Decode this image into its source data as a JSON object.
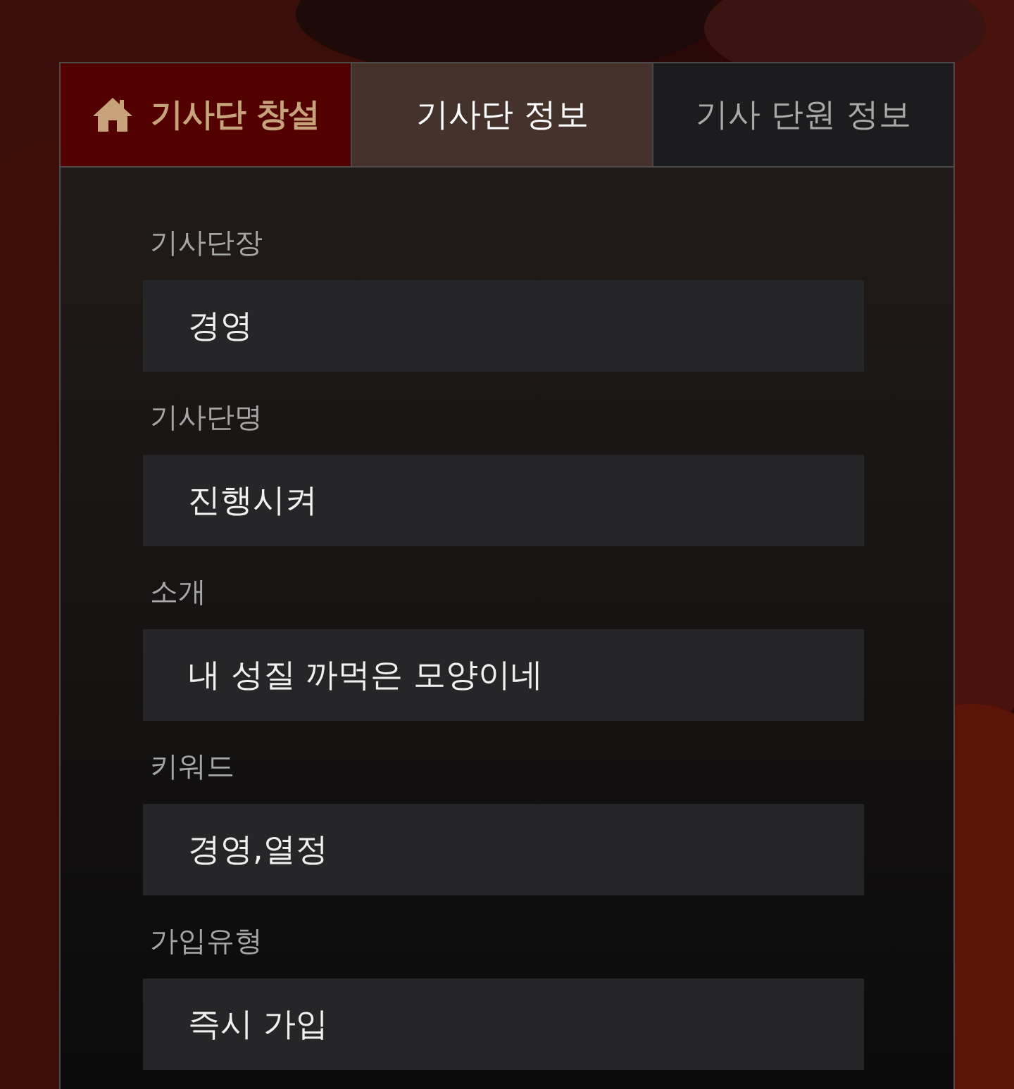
{
  "tabs": [
    {
      "label": "기사단 창설",
      "kind": "action",
      "selected": false
    },
    {
      "label": "기사단 정보",
      "kind": "tab",
      "selected": true
    },
    {
      "label": "기사 단원 정보",
      "kind": "tab",
      "selected": false
    }
  ],
  "fields": [
    {
      "label": "기사단장",
      "value": "경영"
    },
    {
      "label": "기사단명",
      "value": "진행시켜"
    },
    {
      "label": "소개",
      "value": "내 성질 까먹은 모양이네"
    },
    {
      "label": "키워드",
      "value": "경영,열정"
    },
    {
      "label": "가입유형",
      "value": "즉시 가입"
    }
  ]
}
